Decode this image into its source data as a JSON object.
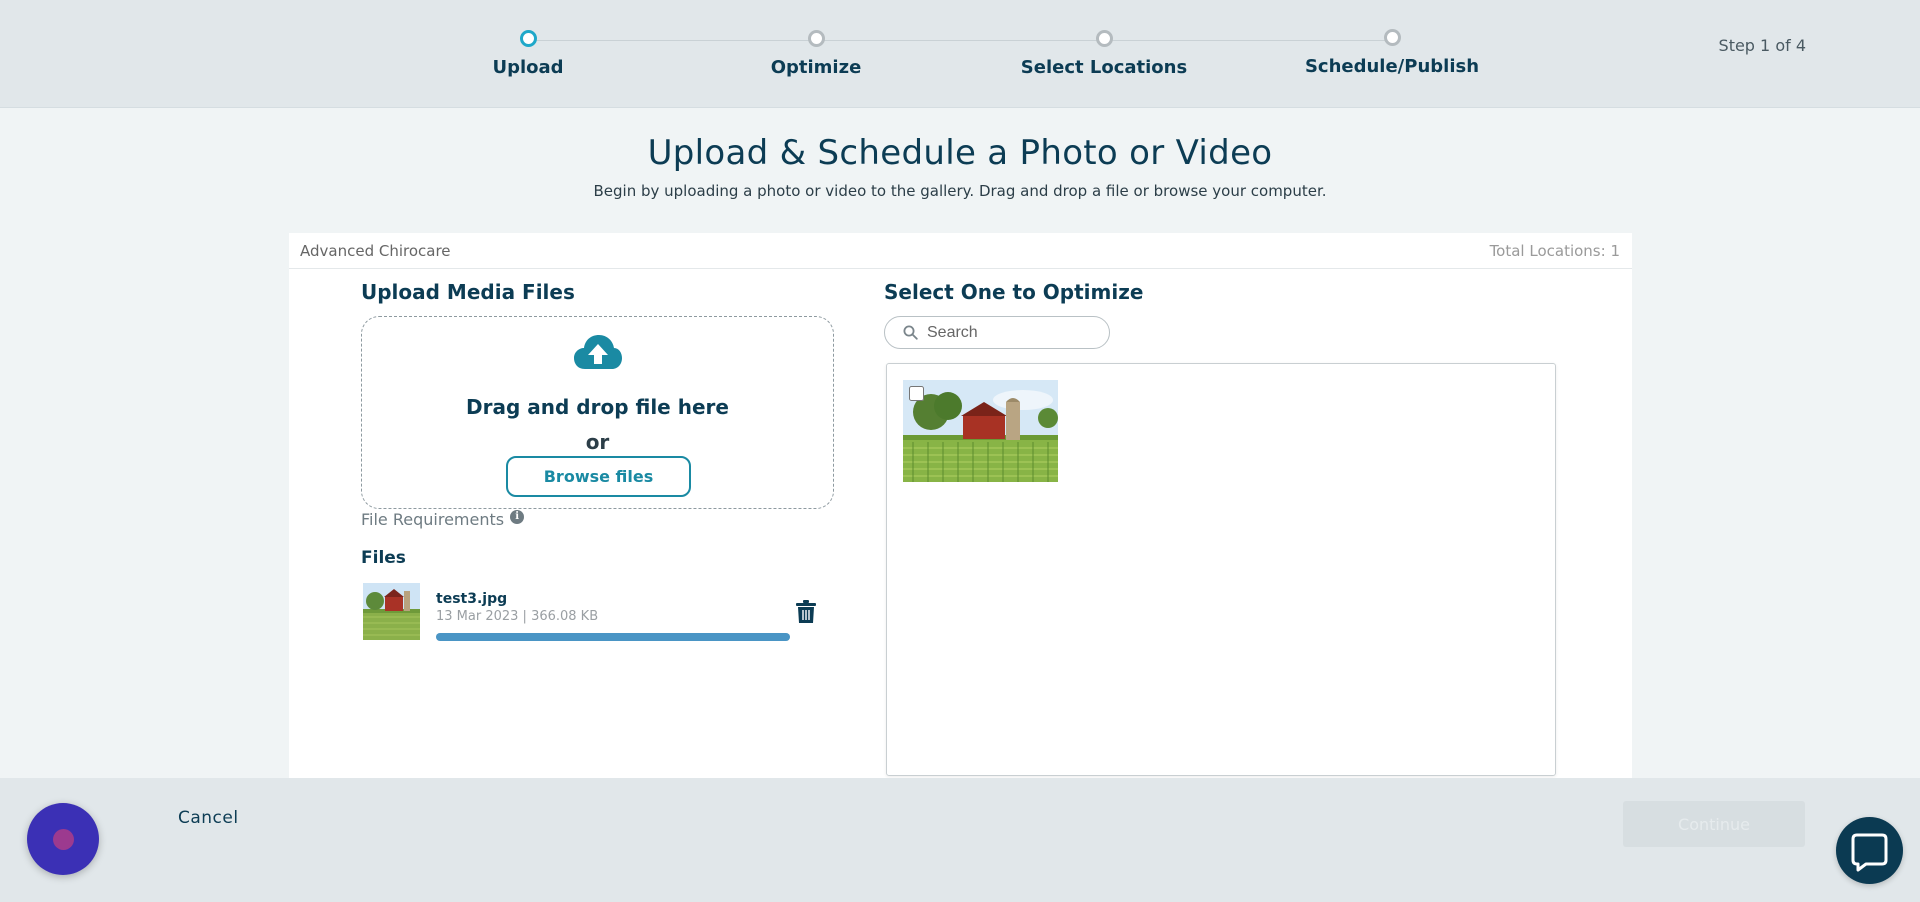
{
  "stepper": {
    "steps": [
      {
        "label": "Upload",
        "active": true
      },
      {
        "label": "Optimize",
        "active": false
      },
      {
        "label": "Select Locations",
        "active": false
      },
      {
        "label": "Schedule/Publish",
        "active": false
      }
    ],
    "step_count": "Step 1 of 4"
  },
  "header": {
    "title": "Upload & Schedule a Photo or Video",
    "subtitle": "Begin by uploading a photo or video to the gallery. Drag and drop a file or browse your computer."
  },
  "card": {
    "business_name": "Advanced Chirocare",
    "total_locations": "Total Locations: 1"
  },
  "upload": {
    "section_title": "Upload Media Files",
    "dropzone_text": "Drag and drop file here",
    "or_text": "or",
    "browse_label": "Browse files",
    "file_requirements": "File Requirements",
    "files_title": "Files",
    "files": [
      {
        "name": "test3.jpg",
        "meta": "13 Mar 2023 |  366.08 KB",
        "progress": 1.0
      }
    ]
  },
  "optimize": {
    "section_title": "Select One to Optimize",
    "search_placeholder": "Search"
  },
  "footer": {
    "cancel_label": "Cancel",
    "continue_label": "Continue"
  },
  "colors": {
    "accent": "#1fa8c9",
    "brand_dark": "#0c3c54",
    "button_teal": "#1a8aa3",
    "progress": "#4a95c5",
    "chat_left": "#3b30b5",
    "chat_right": "#0b3a52"
  },
  "icons": {
    "upload": "cloud-upload-icon",
    "info": "info-icon",
    "trash": "trash-icon",
    "search": "search-icon",
    "chat": "chat-bubble-icon"
  }
}
